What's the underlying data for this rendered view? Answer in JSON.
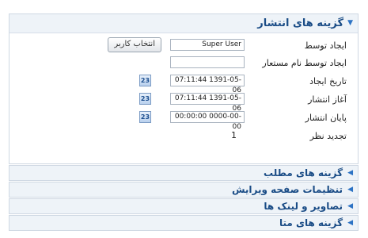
{
  "panel": {
    "title": "گزینه های انتشار",
    "fields": {
      "created_by_label": "ایجاد توسط",
      "created_by_value": "Super User",
      "select_user_label": "انتخاب کاربر",
      "created_by_alias_label": "ایجاد توسط نام مستعار",
      "created_by_alias_value": "",
      "created_date_label": "تاریخ ایجاد",
      "created_date_value": "07:11:44 1391-05-06",
      "publish_up_label": "آغاز انتشار",
      "publish_up_value": "07:11:44 1391-05-06",
      "publish_down_label": "پایان انتشار",
      "publish_down_value": "00:00:00 0000-00-00",
      "revision_label": "تجدید نظر",
      "revision_value": "1",
      "calendar_icon_text": "23"
    }
  },
  "collapsed_sections": [
    "گزینه های مطلب",
    "تنظیمات صفحه ویرایش",
    "تصاویر و لینک ها",
    "گزینه های متا"
  ],
  "colors": {
    "header_text": "#1a4c86",
    "header_bg": "#eef3f8",
    "border": "#cfd8e3",
    "arrow": "#2d73c4"
  },
  "icons": {
    "expanded": "triangle-down-icon",
    "collapsed": "triangle-left-icon",
    "calendar": "calendar-icon"
  }
}
